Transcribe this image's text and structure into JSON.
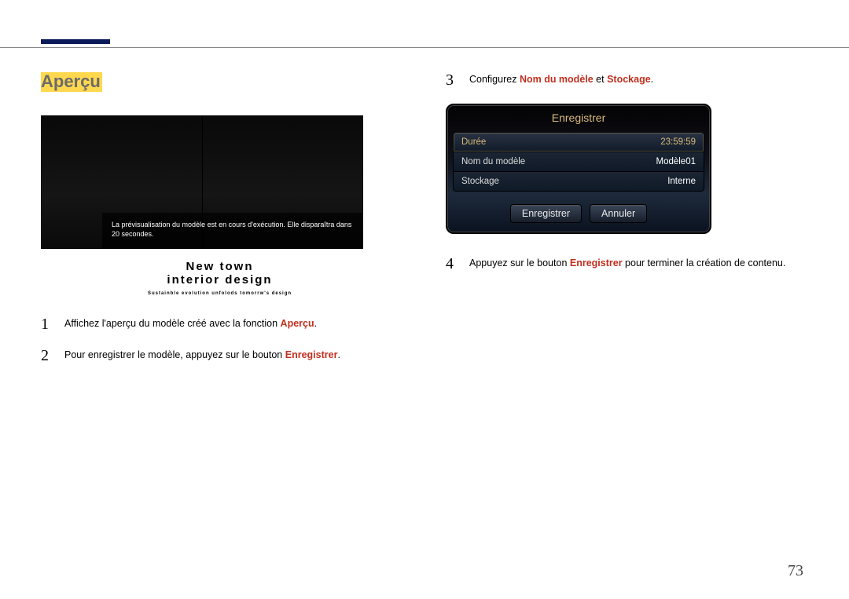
{
  "page_number": "73",
  "section_title": "Aperçu",
  "preview_overlay": "La prévisualisation du modèle est en cours d'exécution. Elle disparaîtra dans 20 secondes.",
  "template_title_line1": "New town",
  "template_title_line2": "interior design",
  "template_subtitle": "Sustainble evolution unfolods tomorrw's design",
  "left_steps": {
    "s1": {
      "num": "1",
      "pre": "Affichez l'aperçu du modèle créé avec la fonction ",
      "kw": "Aperçu",
      "post": "."
    },
    "s2": {
      "num": "2",
      "pre": "Pour enregistrer le modèle, appuyez sur le bouton ",
      "kw": "Enregistrer",
      "post": "."
    }
  },
  "right_steps": {
    "s3": {
      "num": "3",
      "pre": "Configurez ",
      "kw1": "Nom du modèle",
      "mid": " et ",
      "kw2": "Stockage",
      "post": "."
    },
    "s4": {
      "num": "4",
      "pre": "Appuyez sur le bouton ",
      "kw": "Enregistrer",
      "post": " pour terminer la création de contenu."
    }
  },
  "dialog": {
    "title": "Enregistrer",
    "rows": [
      {
        "label": "Durée",
        "value": "23:59:59",
        "active": true
      },
      {
        "label": "Nom du modèle",
        "value": "Modèle01",
        "active": false
      },
      {
        "label": "Stockage",
        "value": "Interne",
        "active": false
      }
    ],
    "save": "Enregistrer",
    "cancel": "Annuler"
  }
}
